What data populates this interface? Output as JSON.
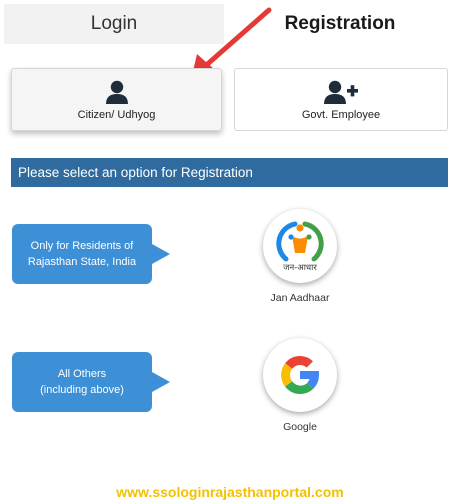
{
  "tabs": {
    "login": "Login",
    "registration": "Registration"
  },
  "cards": {
    "citizen": "Citizen/ Udhyog",
    "govt": "Govt. Employee"
  },
  "banner": "Please select an option for Registration",
  "options": {
    "residents_bubble_line1": "Only for Residents of",
    "residents_bubble_line2": "Rajasthan State, India",
    "others_bubble_line1": "All Others",
    "others_bubble_line2": "(including above)",
    "jan_aadhaar_label": "Jan Aadhaar",
    "jan_aadhaar_logo_text": "जन-आधार",
    "google_label": "Google"
  },
  "watermark": "www.ssologinrajasthanportal.com",
  "colors": {
    "banner": "#2f6b9e",
    "bubble": "#3d8fd6",
    "arrow": "#e53935",
    "watermark": "#f2c200",
    "icon_dark": "#1f2d3a"
  },
  "icons": {
    "citizen": "user-icon",
    "govt": "user-plus-icon",
    "jan_aadhaar": "jan-aadhaar-logo",
    "google": "google-logo",
    "pointer": "red-arrow-icon"
  }
}
